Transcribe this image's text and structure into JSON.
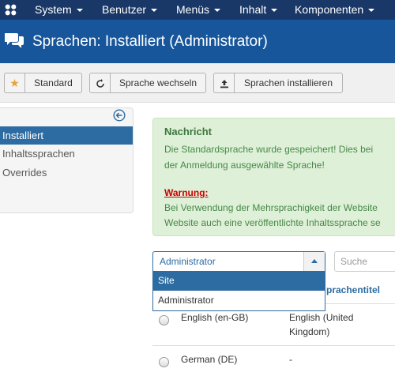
{
  "nav": {
    "items": [
      "System",
      "Benutzer",
      "Menüs",
      "Inhalt",
      "Komponenten"
    ]
  },
  "header": {
    "title": "Sprachen: Installiert (Administrator)",
    "icon": "chat-bubbles-icon"
  },
  "toolbar": {
    "standard": "Standard",
    "switch": "Sprache wechseln",
    "install": "Sprachen installieren"
  },
  "sidebar": {
    "items": [
      "Installiert",
      "Inhaltssprachen",
      "Overrides"
    ],
    "active_index": 0
  },
  "message": {
    "heading": "Nachricht",
    "line1": "Die Standardsprache wurde gespeichert! Dies bei",
    "line2": "der Anmeldung ausgewählte Sprache!",
    "warning_label": "Warnung:",
    "line3": "Bei Verwendung der Mehrsprachigkeit der Website",
    "line4": "Website auch eine veröffentlichte Inhaltssprache se"
  },
  "filter": {
    "client_value": "Administrator",
    "options": [
      "Site",
      "Administrator"
    ],
    "highlighted_index": 0,
    "search_placeholder": "Suche"
  },
  "table": {
    "col_title": "prachentitel",
    "rows": [
      {
        "name": "English (en-GB)",
        "title_line1": "English (United",
        "title_line2": "Kingdom)"
      },
      {
        "name": "German (DE)",
        "title_line1": "-",
        "title_line2": ""
      }
    ]
  },
  "colors": {
    "nav_bg": "#1a3867",
    "header_bg": "#17569b",
    "accent": "#2d6ca2",
    "success_bg": "#dff0d8",
    "star": "#e8a23a"
  }
}
